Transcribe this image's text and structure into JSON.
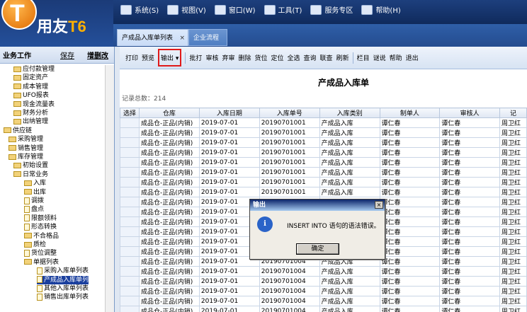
{
  "app": {
    "logo_t": "T",
    "logo_text": "用友",
    "logo_t6": "T6"
  },
  "menu": [
    {
      "label": "系统(S)",
      "icon": "system-icon"
    },
    {
      "label": "视图(V)",
      "icon": "view-icon"
    },
    {
      "label": "窗口(W)",
      "icon": "window-icon"
    },
    {
      "label": "工具(T)",
      "icon": "tools-icon"
    },
    {
      "label": "服务专区",
      "icon": "service-icon"
    },
    {
      "label": "帮助(H)",
      "icon": "help-icon"
    }
  ],
  "tabs": [
    {
      "label": "产成品入库单列表",
      "close": "×"
    },
    {
      "label": "企业流程"
    }
  ],
  "leftpanel": {
    "title": "业务工作",
    "save": "保存",
    "tree_label": "增删改"
  },
  "tree": [
    {
      "label": "应付款管理",
      "t": "folder",
      "lvl": 2
    },
    {
      "label": "固定资产",
      "t": "folder",
      "lvl": 2
    },
    {
      "label": "成本管理",
      "t": "folder",
      "lvl": 2
    },
    {
      "label": "UFO报表",
      "t": "folder",
      "lvl": 2
    },
    {
      "label": "现金流量表",
      "t": "folder",
      "lvl": 2
    },
    {
      "label": "财务分析",
      "t": "folder",
      "lvl": 2
    },
    {
      "label": "出纳管理",
      "t": "folder",
      "lvl": 2
    },
    {
      "label": "供应链",
      "t": "folder",
      "lvl": 0
    },
    {
      "label": "采购管理",
      "t": "folder",
      "lvl": 1
    },
    {
      "label": "销售管理",
      "t": "folder",
      "lvl": 1
    },
    {
      "label": "库存管理",
      "t": "folder",
      "lvl": 1
    },
    {
      "label": "初始设置",
      "t": "folder",
      "lvl": 2
    },
    {
      "label": "日常业务",
      "t": "folder",
      "lvl": 2
    },
    {
      "label": "入库",
      "t": "folder",
      "lvl": 3
    },
    {
      "label": "出库",
      "t": "folder",
      "lvl": 3
    },
    {
      "label": "调拨",
      "t": "doc",
      "lvl": 3
    },
    {
      "label": "盘点",
      "t": "doc",
      "lvl": 3
    },
    {
      "label": "限额领料",
      "t": "doc",
      "lvl": 3
    },
    {
      "label": "形态转换",
      "t": "doc",
      "lvl": 3
    },
    {
      "label": "不合格品",
      "t": "folder",
      "lvl": 3
    },
    {
      "label": "质检",
      "t": "folder",
      "lvl": 3
    },
    {
      "label": "货位调整",
      "t": "doc",
      "lvl": 3
    },
    {
      "label": "单据列表",
      "t": "folder",
      "lvl": 3
    },
    {
      "label": "采购入库单列表",
      "t": "doc",
      "lvl": 4
    },
    {
      "label": "产成品入库单列",
      "t": "doc",
      "lvl": 4,
      "sel": true
    },
    {
      "label": "其他入库单列表",
      "t": "doc",
      "lvl": 4
    },
    {
      "label": "销售出库单列表",
      "t": "doc",
      "lvl": 4
    }
  ],
  "toolbar": [
    "打印",
    "预览",
    "输出 ▾",
    "批打",
    "审核",
    "弃审",
    "删除",
    "货位",
    "定位",
    "全选",
    "查询",
    "联查",
    "刷新",
    "栏目",
    "谜说",
    "帮助",
    "退出"
  ],
  "content": {
    "title": "产成品入库单",
    "total": "记录总数：214"
  },
  "table": {
    "headers": [
      "选择",
      "仓库",
      "入库日期",
      "入库单号",
      "入库类别",
      "制单人",
      "审核人",
      "记"
    ],
    "rows": [
      [
        "",
        "成品仓-正品(内销)",
        "2019-07-01",
        "20190701001",
        "产成品入库",
        "谭仁春",
        "谭仁春",
        "周卫红"
      ],
      [
        "",
        "成品仓-正品(内销)",
        "2019-07-01",
        "20190701001",
        "产成品入库",
        "谭仁春",
        "谭仁春",
        "周卫红"
      ],
      [
        "",
        "成品仓-正品(内销)",
        "2019-07-01",
        "20190701001",
        "产成品入库",
        "谭仁春",
        "谭仁春",
        "周卫红"
      ],
      [
        "",
        "成品仓-正品(内销)",
        "2019-07-01",
        "20190701001",
        "产成品入库",
        "谭仁春",
        "谭仁春",
        "周卫红"
      ],
      [
        "",
        "成品仓-正品(内销)",
        "2019-07-01",
        "20190701001",
        "产成品入库",
        "谭仁春",
        "谭仁春",
        "周卫红"
      ],
      [
        "",
        "成品仓-正品(内销)",
        "2019-07-01",
        "20190701001",
        "产成品入库",
        "谭仁春",
        "谭仁春",
        "周卫红"
      ],
      [
        "",
        "成品仓-正品(内销)",
        "2019-07-01",
        "20190701001",
        "产成品入库",
        "谭仁春",
        "谭仁春",
        "周卫红"
      ],
      [
        "",
        "成品仓-正品(内销)",
        "2019-07-01",
        "20190701001",
        "产成品入库",
        "谭仁春",
        "谭仁春",
        "周卫红"
      ],
      [
        "",
        "成品仓-正品(内销)",
        "2019-07-01",
        "20190701001",
        "产成品入库",
        "谭仁春",
        "谭仁春",
        "周卫红"
      ],
      [
        "",
        "成品仓-正品(内销)",
        "2019-07-01",
        "20190701001",
        "产成品入库",
        "谭仁春",
        "谭仁春",
        "周卫红"
      ],
      [
        "",
        "成品仓-正品(内销)",
        "2019-07-01",
        "20190701001",
        "产成品入库",
        "谭仁春",
        "谭仁春",
        "周卫红"
      ],
      [
        "",
        "成品仓-正品(内销)",
        "2019-07-01",
        "20190701001",
        "产成品入库",
        "谭仁春",
        "谭仁春",
        "周卫红"
      ],
      [
        "",
        "成品仓-正品(内销)",
        "2019-07-01",
        "20190701001",
        "产成品入库",
        "谭仁春",
        "谭仁春",
        "周卫红"
      ],
      [
        "",
        "成品仓-正品(内销)",
        "2019-07-01",
        "20190701004",
        "产成品入库",
        "谭仁春",
        "谭仁春",
        "周卫红"
      ],
      [
        "",
        "成品仓-正品(内销)",
        "2019-07-01",
        "20190701004",
        "产成品入库",
        "谭仁春",
        "谭仁春",
        "周卫红"
      ],
      [
        "",
        "成品仓-正品(内销)",
        "2019-07-01",
        "20190701004",
        "产成品入库",
        "谭仁春",
        "谭仁春",
        "周卫红"
      ],
      [
        "",
        "成品仓-正品(内销)",
        "2019-07-01",
        "20190701004",
        "产成品入库",
        "谭仁春",
        "谭仁春",
        "周卫红"
      ],
      [
        "",
        "成品仓-正品(内销)",
        "2019-07-01",
        "20190701004",
        "产成品入库",
        "谭仁春",
        "谭仁春",
        "周卫红"
      ],
      [
        "",
        "成品仓-正品(内销)",
        "2019-07-01",
        "20190701004",
        "产成品入库",
        "谭仁春",
        "谭仁春",
        "周卫红"
      ],
      [
        "",
        "成品仓-正品(内销)",
        "2019-07-01",
        "20190701004",
        "产成品入库",
        "谭仁春",
        "谭仁春",
        "周卫红"
      ]
    ]
  },
  "dialog": {
    "title": "输出",
    "close": "×",
    "message": "INSERT INTO 语句的语法错误。",
    "ok": "确定",
    "icon": "info-icon"
  }
}
